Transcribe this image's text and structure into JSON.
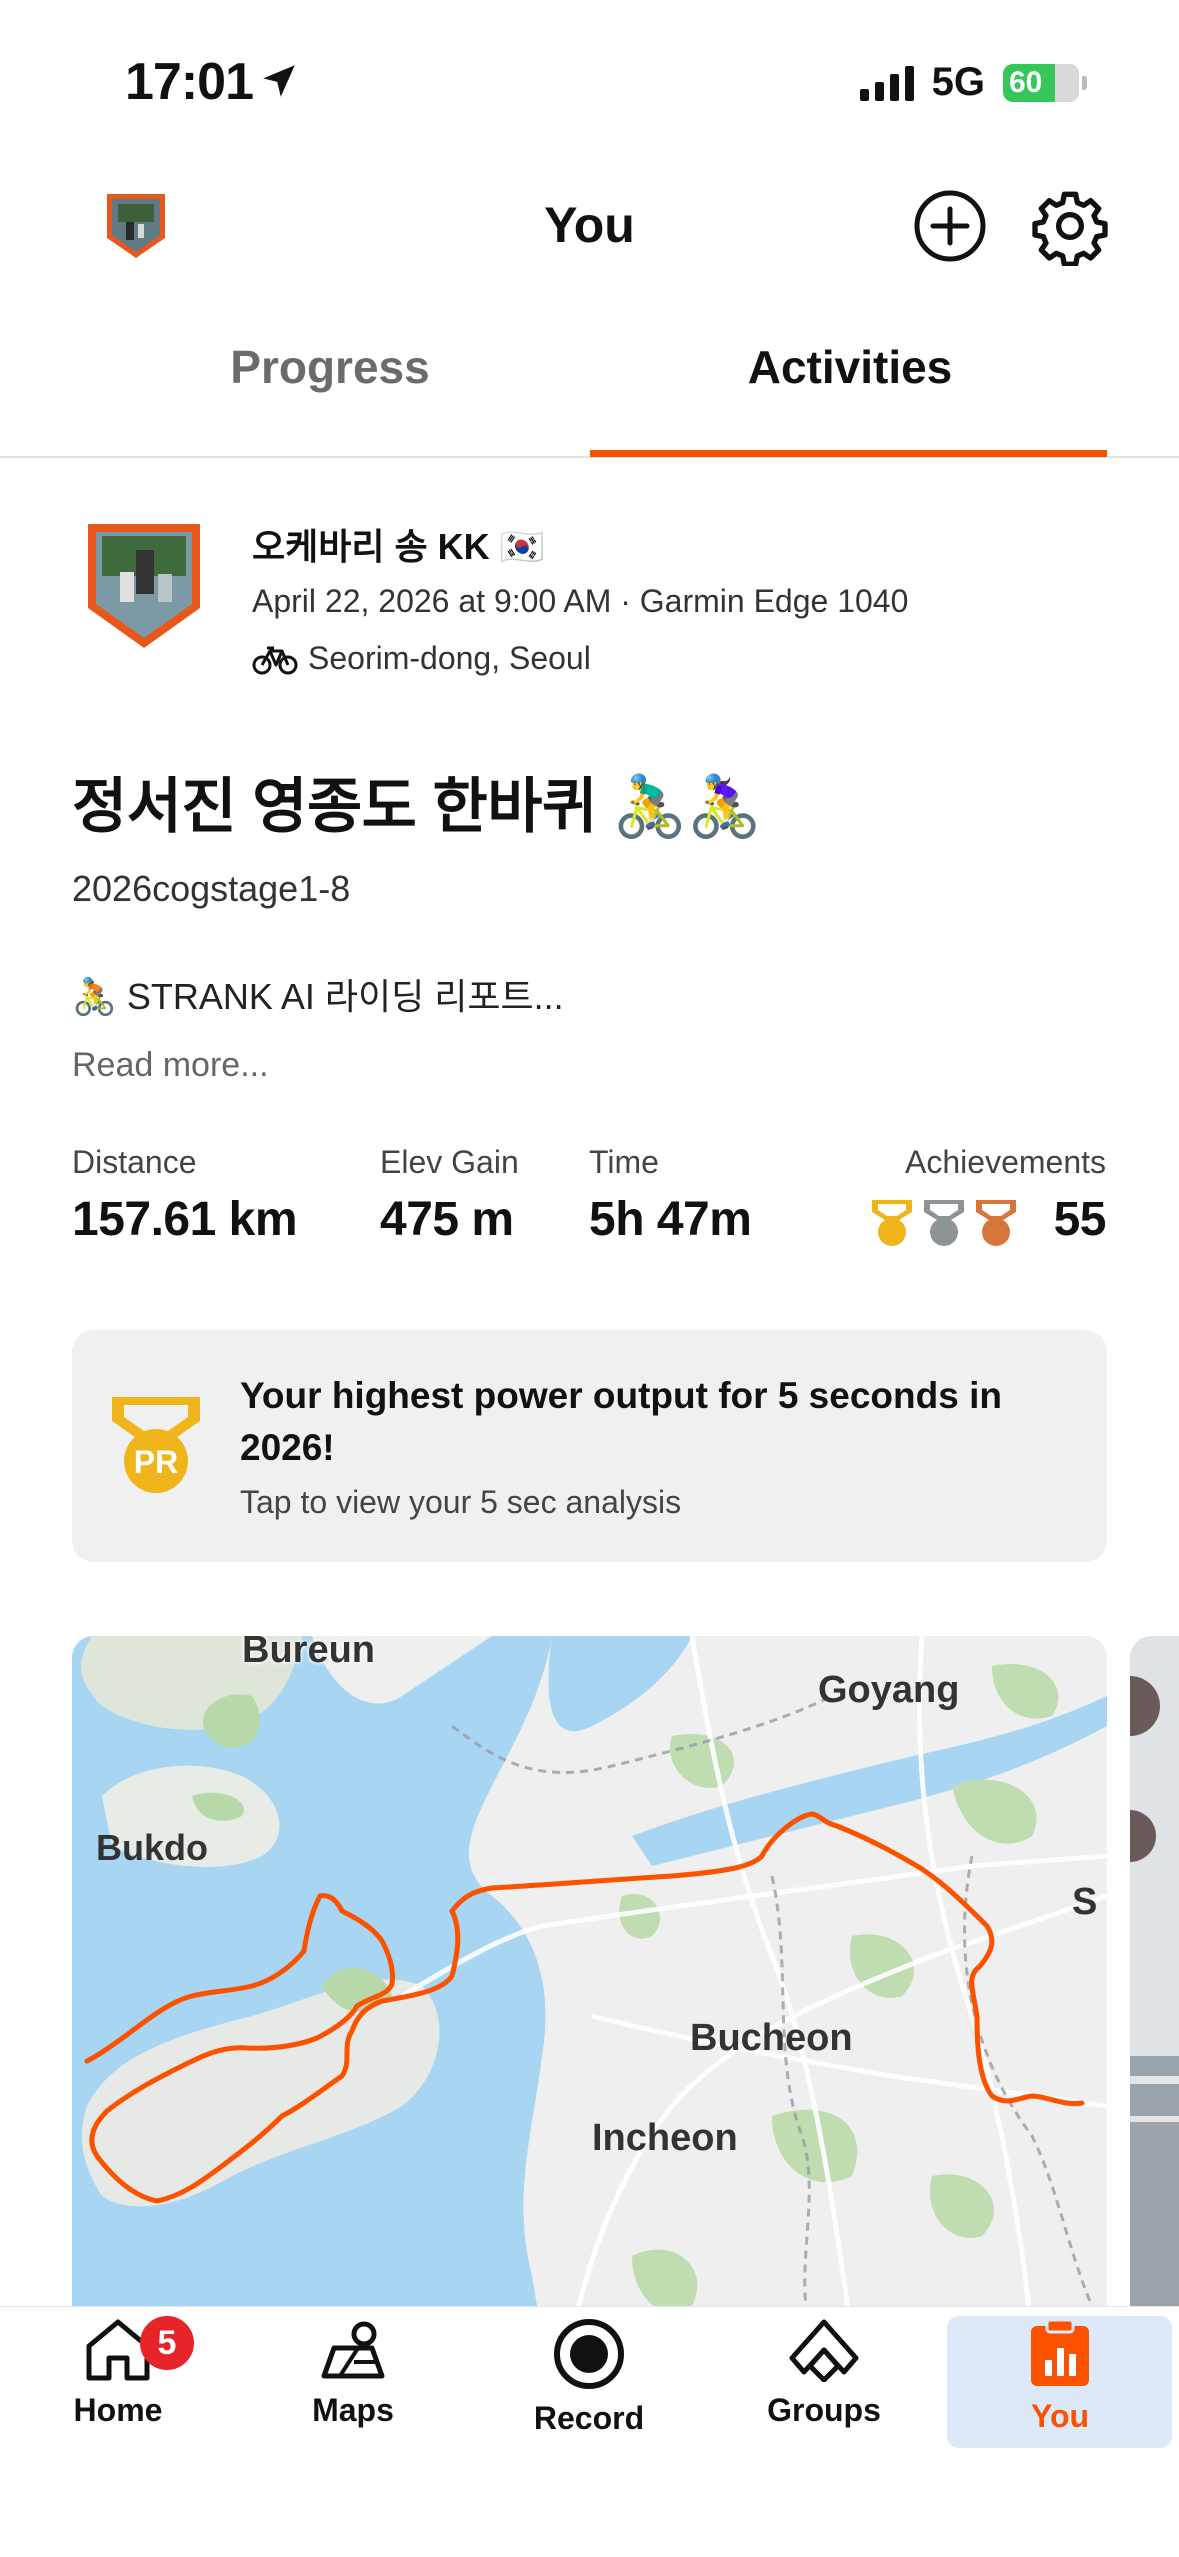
{
  "status_bar": {
    "time": "17:01",
    "network": "5G",
    "battery": "60"
  },
  "header": {
    "title": "You"
  },
  "tabs": [
    {
      "label": "Progress",
      "active": false
    },
    {
      "label": "Activities",
      "active": true
    }
  ],
  "activity": {
    "athlete_name": "오케바리 송 KK 🇰🇷",
    "meta": "April 22, 2026 at 9:00 AM · Garmin Edge 1040",
    "location": "Seorim-dong, Seoul",
    "title": "정서진 영종도 한바퀴 🚴‍♂️🚴‍♀️",
    "subtitle": "2026cogstage1-8",
    "description": "🚴 STRANK AI 라이딩 리포트...",
    "read_more": "Read more...",
    "stats": [
      {
        "label": "Distance",
        "value": "157.61 km"
      },
      {
        "label": "Elev Gain",
        "value": "475 m"
      },
      {
        "label": "Time",
        "value": "5h 47m"
      },
      {
        "label": "Achievements",
        "value": "55"
      }
    ],
    "pr": {
      "badge": "PR",
      "title": "Your highest power output for 5 seconds in 2026!",
      "subtitle": "Tap to view your 5 sec analysis"
    },
    "map_labels": {
      "bureun": "Bureun",
      "goyang": "Goyang",
      "bukdo": "Bukdo",
      "bucheon": "Bucheon",
      "incheon": "Incheon",
      "s": "S"
    }
  },
  "colors": {
    "accent": "#fc5200",
    "gold": "#f1b51c",
    "silver": "#8c9498",
    "bronze": "#d7753a"
  },
  "nav": [
    {
      "label": "Home",
      "badge": "5"
    },
    {
      "label": "Maps"
    },
    {
      "label": "Record"
    },
    {
      "label": "Groups"
    },
    {
      "label": "You",
      "active": true
    }
  ]
}
